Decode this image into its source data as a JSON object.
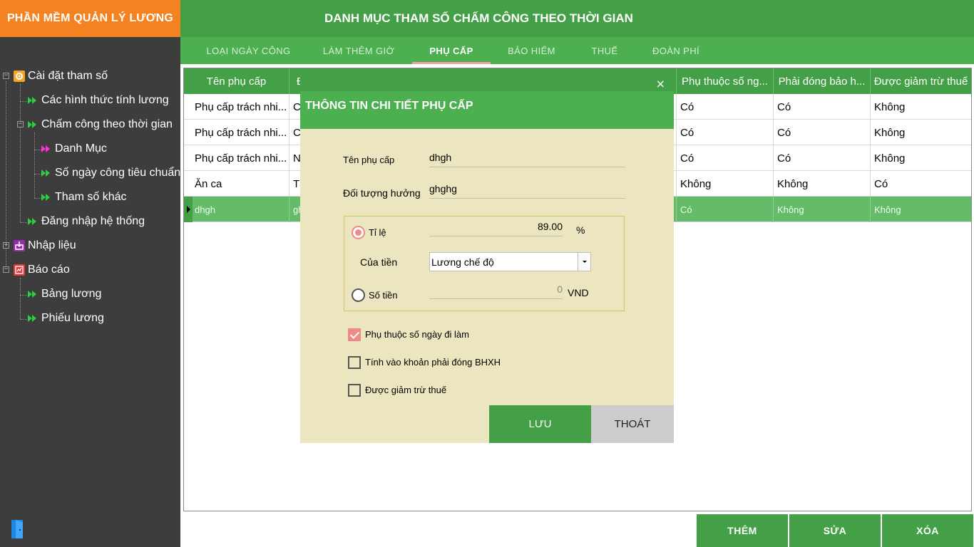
{
  "app": {
    "title": "PHẦN MỀM QUẢN LÝ LƯƠNG"
  },
  "sidebar": {
    "items": [
      {
        "label": "Cài đặt tham số",
        "icon": "gear-icon"
      },
      {
        "label": "Các hình thức tính lương",
        "icon": "double-arrow-icon"
      },
      {
        "label": "Chấm công theo thời gian",
        "icon": "double-arrow-icon"
      },
      {
        "label": "Danh Mục",
        "icon": "double-arrow-icon"
      },
      {
        "label": "Số ngày công tiêu chuẩn",
        "icon": "double-arrow-icon"
      },
      {
        "label": "Tham số khác",
        "icon": "double-arrow-icon"
      },
      {
        "label": "Đăng nhập hệ thống",
        "icon": "double-arrow-icon"
      },
      {
        "label": "Nhập liệu",
        "icon": "import-icon"
      },
      {
        "label": "Báo cáo",
        "icon": "report-icon"
      },
      {
        "label": "Bảng lương",
        "icon": "double-arrow-icon"
      },
      {
        "label": "Phiếu lương",
        "icon": "double-arrow-icon"
      }
    ]
  },
  "header": {
    "title": "DANH MỤC THAM SỐ CHẤM CÔNG THEO THỜI GIAN"
  },
  "tabs": [
    {
      "label": "LOẠI NGÀY CÔNG"
    },
    {
      "label": "LÀM THÊM GIỜ"
    },
    {
      "label": "PHỤ CẤP"
    },
    {
      "label": "BẢO HIỂM"
    },
    {
      "label": "THUẾ"
    },
    {
      "label": "ĐOÀN PHÍ"
    }
  ],
  "grid": {
    "columns": [
      "Tên phụ cấp",
      "Đ",
      "Phụ thuộc số ng...",
      "Phải đóng bảo h...",
      "Được giảm trừ thuế"
    ],
    "rows": [
      [
        "Phụ cấp trách nhi...",
        "C",
        "Có",
        "Có",
        "Không"
      ],
      [
        "Phụ cấp trách nhi...",
        "C",
        "Có",
        "Có",
        "Không"
      ],
      [
        "Phụ cấp trách nhi...",
        "N",
        "Có",
        "Có",
        "Không"
      ],
      [
        "Ăn ca",
        "Tấ",
        "Không",
        "Không",
        "Có"
      ],
      [
        "dhgh",
        "gh",
        "Có",
        "Không",
        "Không"
      ]
    ]
  },
  "dialog": {
    "title": "THÔNG TIN CHI TIẾT PHỤ CẤP",
    "close": "×",
    "name_label": "Tên phụ cấp",
    "name_value": "dhgh",
    "target_label": "Đối tượng hưởng",
    "target_value": "ghghg",
    "rate_label": "Tỉ lệ",
    "rate_value": "89.00",
    "rate_unit": "%",
    "of_money_label": "Của tiền",
    "of_money_value": "Lương chế độ",
    "amount_label": "Số tiền",
    "amount_value": "0",
    "amount_unit": "VND",
    "chk_days_label": "Phụ thuộc số ngày đi làm",
    "chk_bhxh_label": "Tính vào khoản phải đóng BHXH",
    "chk_tax_label": "Được giảm trừ thuế",
    "save_label": "LƯU",
    "exit_label": "THOÁT"
  },
  "actions": {
    "add": "THÊM",
    "edit": "SỬA",
    "delete": "XÓA"
  },
  "colors": {
    "green": "#43a047",
    "orange": "#f58220",
    "sidebar": "#3d3d3d",
    "dialog_bg": "#ebe6c0",
    "accent_pink": "#f08a8a"
  }
}
